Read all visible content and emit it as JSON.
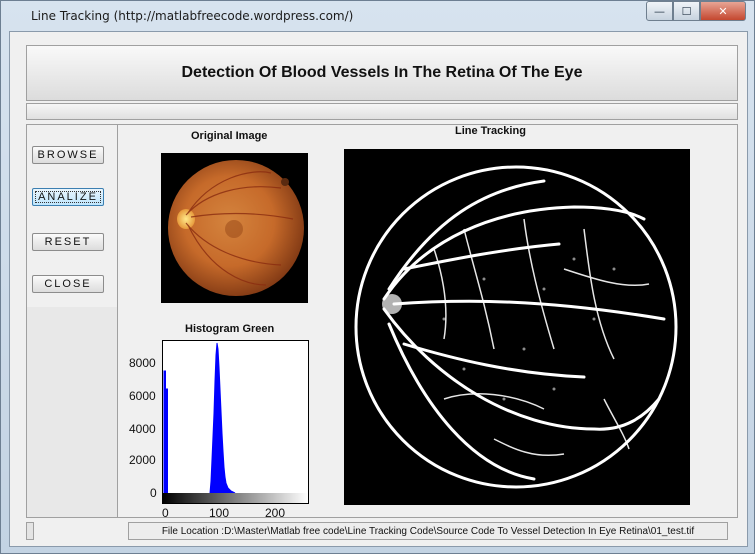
{
  "window": {
    "title": "Line Tracking (http://matlabfreecode.wordpress.com/)",
    "min_glyph": "—",
    "max_glyph": "☐",
    "close_glyph": "✕"
  },
  "header": {
    "title": "Detection Of Blood Vessels In The Retina Of The Eye"
  },
  "buttons": {
    "browse": "BROWSE",
    "analize": "ANALIZE",
    "reset": "RESET",
    "close": "CLOSE"
  },
  "panels": {
    "original_title": "Original Image",
    "histogram_title": "Histogram Green",
    "line_tracking_title": "Line Tracking"
  },
  "histogram": {
    "y_ticks": [
      "8000",
      "6000",
      "4000",
      "2000",
      "0"
    ],
    "x_ticks": [
      "0",
      "100",
      "200"
    ],
    "bar_color": "#0000ff"
  },
  "status": {
    "file_location": "File Location :D:\\Master\\Matlab free code\\Line Tracking Code\\Source Code To Vessel Detection In Eye Retina\\01_test.tif"
  }
}
